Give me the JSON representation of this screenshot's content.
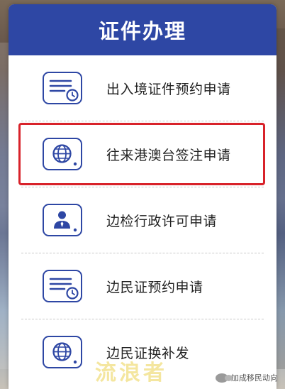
{
  "header": {
    "title": "证件办理"
  },
  "items": [
    {
      "label": "出入境证件预约申请",
      "icon": "document-clock-icon"
    },
    {
      "label": "往来港澳台签注申请",
      "icon": "globe-icon"
    },
    {
      "label": "边检行政许可申请",
      "icon": "officer-icon"
    },
    {
      "label": "边民证预约申请",
      "icon": "document-clock-icon"
    },
    {
      "label": "边民证换补发",
      "icon": "globe-icon"
    }
  ],
  "highlighted_item": 1,
  "colors": {
    "brand": "#2e47a4",
    "highlight": "#d8222a"
  },
  "watermark": {
    "logo_text": "流浪者",
    "account": "加成移民动向"
  }
}
